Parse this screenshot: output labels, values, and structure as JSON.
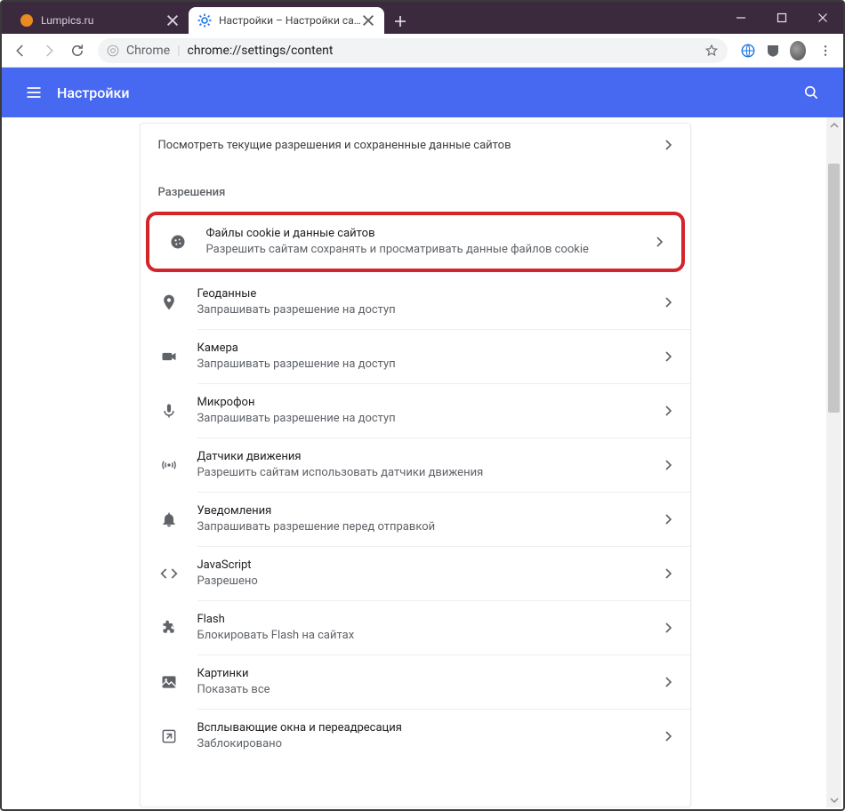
{
  "window": {
    "tabs": [
      {
        "title": "Lumpics.ru",
        "active": false
      },
      {
        "title": "Настройки – Настройки сайта",
        "active": true
      }
    ]
  },
  "omnibox": {
    "chip": "Chrome",
    "url": "chrome://settings/content"
  },
  "header": {
    "title": "Настройки"
  },
  "content": {
    "view_permissions_row": "Посмотреть текущие разрешения и сохраненные данные сайтов",
    "section_label": "Разрешения",
    "permissions": [
      {
        "icon": "cookie",
        "title": "Файлы cookie и данные сайтов",
        "sub": "Разрешить сайтам сохранять и просматривать данные файлов cookie",
        "highlighted": true
      },
      {
        "icon": "location",
        "title": "Геоданные",
        "sub": "Запрашивать разрешение на доступ"
      },
      {
        "icon": "camera",
        "title": "Камера",
        "sub": "Запрашивать разрешение на доступ"
      },
      {
        "icon": "mic",
        "title": "Микрофон",
        "sub": "Запрашивать разрешение на доступ"
      },
      {
        "icon": "sensors",
        "title": "Датчики движения",
        "sub": "Разрешить сайтам использовать датчики движения"
      },
      {
        "icon": "bell",
        "title": "Уведомления",
        "sub": "Запрашивать разрешение перед отправкой"
      },
      {
        "icon": "code",
        "title": "JavaScript",
        "sub": "Разрешено"
      },
      {
        "icon": "puzzle",
        "title": "Flash",
        "sub": "Блокировать Flash на сайтах"
      },
      {
        "icon": "image",
        "title": "Картинки",
        "sub": "Показать все"
      },
      {
        "icon": "popup",
        "title": "Всплывающие окна и переадресация",
        "sub": "Заблокировано"
      }
    ]
  }
}
